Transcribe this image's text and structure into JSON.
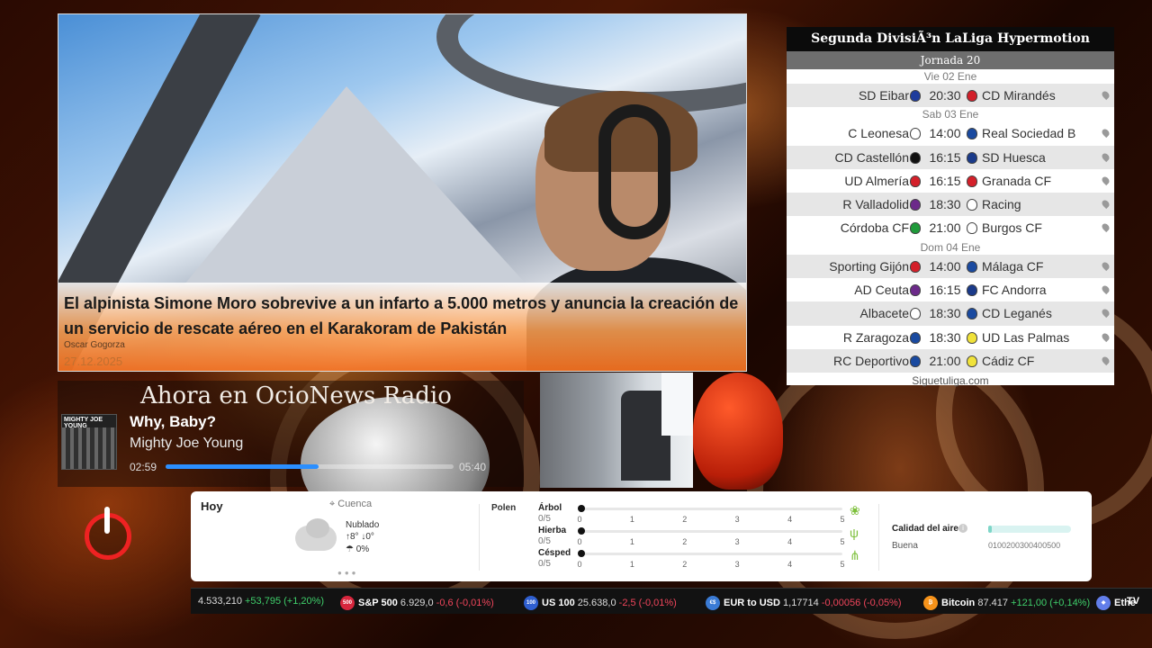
{
  "news": {
    "title": "El alpinista Simone Moro sobrevive a un infarto a 5.000 metros y anuncia la creación de un servicio de rescate aéreo en el Karakoram de Pakistán",
    "author": "Oscar Gogorza",
    "date": "27.12.2025"
  },
  "radio": {
    "title": "Ahora en OcioNews Radio",
    "song": "Why, Baby?",
    "artist": "Mighty Joe Young",
    "cover_text": "MIGHTY JOE YOUNG",
    "current_time": "02:59",
    "total_time": "05:40",
    "progress": 0.53
  },
  "league": {
    "title": "Segunda DivisiÃ³n LaLiga Hypermotion",
    "round": "Jornada 20",
    "footer": "Siguetuliga.com",
    "days": [
      {
        "label": "Vie 02 Ene",
        "matches": [
          {
            "home": "SD Eibar",
            "time": "20:30",
            "away": "CD Mirandés",
            "home_color": "#1f3c9c",
            "away_color": "#d21f2a"
          }
        ]
      },
      {
        "label": "Sab 03 Ene",
        "matches": [
          {
            "home": "C Leonesa",
            "time": "14:00",
            "away": "Real Sociedad B",
            "home_color": "#ffffff",
            "away_color": "#1a4aa0"
          },
          {
            "home": "CD Castellón",
            "time": "16:15",
            "away": "SD Huesca",
            "home_color": "#111111",
            "away_color": "#1a3a8a"
          },
          {
            "home": "UD Almería",
            "time": "16:15",
            "away": "Granada CF",
            "home_color": "#d4202a",
            "away_color": "#d4202a"
          },
          {
            "home": "R Valladolid",
            "time": "18:30",
            "away": "Racing",
            "home_color": "#6c2a8a",
            "away_color": "#ffffff"
          },
          {
            "home": "Córdoba CF",
            "time": "21:00",
            "away": "Burgos CF",
            "home_color": "#1f9a3a",
            "away_color": "#ffffff"
          }
        ]
      },
      {
        "label": "Dom 04 Ene",
        "matches": [
          {
            "home": "Sporting Gijón",
            "time": "14:00",
            "away": "Málaga CF",
            "home_color": "#d4202a",
            "away_color": "#1a4aa0"
          },
          {
            "home": "AD Ceuta",
            "time": "16:15",
            "away": "FC Andorra",
            "home_color": "#6c2a8a",
            "away_color": "#1a3a8a"
          },
          {
            "home": "Albacete",
            "time": "18:30",
            "away": "CD Leganés",
            "home_color": "#ffffff",
            "away_color": "#1a4aa0"
          },
          {
            "home": "R Zaragoza",
            "time": "18:30",
            "away": "UD Las Palmas",
            "home_color": "#1a4aa0",
            "away_color": "#f0e23a"
          },
          {
            "home": "RC Deportivo",
            "time": "21:00",
            "away": "Cádiz CF",
            "home_color": "#1a4aa0",
            "away_color": "#f0e23a"
          }
        ]
      }
    ]
  },
  "weather": {
    "today_label": "Hoy",
    "location": "Cuenca",
    "condition": "Nublado",
    "temps": "↑8° ↓0°",
    "rain": "0%",
    "pollen_label": "Polen",
    "pollen": [
      {
        "name": "Árbol",
        "score": "0/5",
        "level": 0,
        "icon": "tree-icon"
      },
      {
        "name": "Hierba",
        "score": "0/5",
        "level": 0,
        "icon": "grass-icon"
      },
      {
        "name": "Césped",
        "score": "0/5",
        "level": 0,
        "icon": "lawn-icon"
      }
    ],
    "pollen_scale": [
      "0",
      "1",
      "2",
      "3",
      "4",
      "5"
    ],
    "air_quality_label": "Calidad del aire",
    "air_quality_status": "Buena",
    "air_quality_scale": "0100200300400500",
    "air_quality_level": 0.03
  },
  "ticker": [
    {
      "name": "",
      "value": "4.533,210",
      "change": "+53,795 (+1,20%)",
      "dir": "up",
      "badge": "",
      "color": ""
    },
    {
      "name": "S&P 500",
      "value": "6.929,0",
      "change": "-0,6 (-0,01%)",
      "dir": "down",
      "badge": "500",
      "color": "#d7263d"
    },
    {
      "name": "US 100",
      "value": "25.638,0",
      "change": "-2,5 (-0,01%)",
      "dir": "down",
      "badge": "100",
      "color": "#2f5fd0"
    },
    {
      "name": "EUR to USD",
      "value": "1,17714",
      "change": "-0,00056 (-0,05%)",
      "dir": "down",
      "badge": "€$",
      "color": "#3a7bd5"
    },
    {
      "name": "Bitcoin",
      "value": "87.417",
      "change": "+121,00 (+0,14%)",
      "dir": "up",
      "badge": "₿",
      "color": "#f7931a"
    },
    {
      "name": "Ethe",
      "value": "",
      "change": "",
      "dir": "up",
      "badge": "◆",
      "color": "#627eea"
    }
  ],
  "ticker_logo": "TV"
}
